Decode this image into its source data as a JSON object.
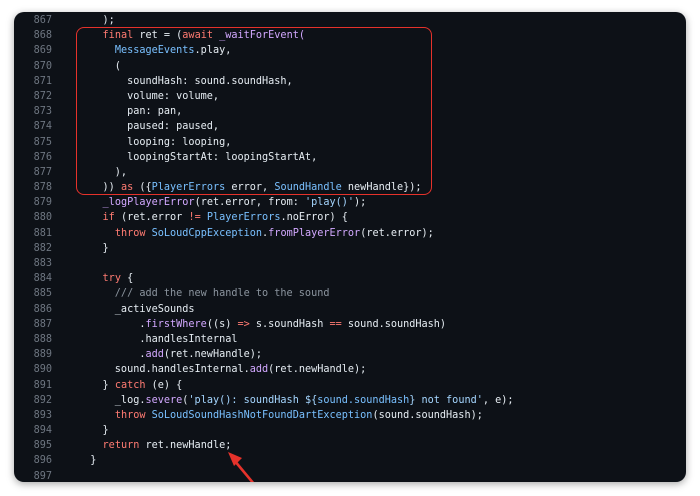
{
  "colors": {
    "background": "#0d1117",
    "keyword": "#ff7b72",
    "function": "#d2a8ff",
    "type": "#79c0ff",
    "string": "#a5d6ff",
    "comment": "#8b949e",
    "plain": "#e6edf3",
    "line_number": "#6e7681",
    "annotation": "#e5322b"
  },
  "code": {
    "lines": [
      {
        "n": "867",
        "tokens": [
          {
            "t": "    );",
            "c": "pl"
          }
        ]
      },
      {
        "n": "868",
        "tokens": [
          {
            "t": "    ",
            "c": "pl"
          },
          {
            "t": "final",
            "c": "kw"
          },
          {
            "t": " ret = (",
            "c": "pl"
          },
          {
            "t": "await",
            "c": "kw"
          },
          {
            "t": " _waitForEvent(",
            "c": "fn"
          }
        ]
      },
      {
        "n": "869",
        "tokens": [
          {
            "t": "      ",
            "c": "pl"
          },
          {
            "t": "MessageEvents",
            "c": "ty"
          },
          {
            "t": ".play,",
            "c": "pl"
          }
        ]
      },
      {
        "n": "870",
        "tokens": [
          {
            "t": "      (",
            "c": "pl"
          }
        ]
      },
      {
        "n": "871",
        "tokens": [
          {
            "t": "        soundHash: sound.soundHash,",
            "c": "pl"
          }
        ]
      },
      {
        "n": "872",
        "tokens": [
          {
            "t": "        volume: volume,",
            "c": "pl"
          }
        ]
      },
      {
        "n": "873",
        "tokens": [
          {
            "t": "        pan: pan,",
            "c": "pl"
          }
        ]
      },
      {
        "n": "874",
        "tokens": [
          {
            "t": "        paused: paused,",
            "c": "pl"
          }
        ]
      },
      {
        "n": "875",
        "tokens": [
          {
            "t": "        looping: looping,",
            "c": "pl"
          }
        ]
      },
      {
        "n": "876",
        "tokens": [
          {
            "t": "        loopingStartAt: loopingStartAt,",
            "c": "pl"
          }
        ]
      },
      {
        "n": "877",
        "tokens": [
          {
            "t": "      ),",
            "c": "pl"
          }
        ]
      },
      {
        "n": "878",
        "tokens": [
          {
            "t": "    )) ",
            "c": "pl"
          },
          {
            "t": "as",
            "c": "kw"
          },
          {
            "t": " ({",
            "c": "pl"
          },
          {
            "t": "PlayerErrors",
            "c": "ty"
          },
          {
            "t": " error, ",
            "c": "pl"
          },
          {
            "t": "SoundHandle",
            "c": "ty"
          },
          {
            "t": " newHandle});",
            "c": "pl"
          }
        ]
      },
      {
        "n": "879",
        "tokens": [
          {
            "t": "    ",
            "c": "pl"
          },
          {
            "t": "_logPlayerError",
            "c": "fn"
          },
          {
            "t": "(ret.error, from: ",
            "c": "pl"
          },
          {
            "t": "'play()'",
            "c": "str"
          },
          {
            "t": ");",
            "c": "pl"
          }
        ]
      },
      {
        "n": "880",
        "tokens": [
          {
            "t": "    ",
            "c": "pl"
          },
          {
            "t": "if",
            "c": "kw"
          },
          {
            "t": " (ret.error ",
            "c": "pl"
          },
          {
            "t": "!=",
            "c": "kw"
          },
          {
            "t": " ",
            "c": "pl"
          },
          {
            "t": "PlayerErrors",
            "c": "ty"
          },
          {
            "t": ".noError) {",
            "c": "pl"
          }
        ]
      },
      {
        "n": "881",
        "tokens": [
          {
            "t": "      ",
            "c": "pl"
          },
          {
            "t": "throw",
            "c": "kw"
          },
          {
            "t": " ",
            "c": "pl"
          },
          {
            "t": "SoLoudCppException",
            "c": "ty"
          },
          {
            "t": ".",
            "c": "pl"
          },
          {
            "t": "fromPlayerError",
            "c": "fn"
          },
          {
            "t": "(ret.error);",
            "c": "pl"
          }
        ]
      },
      {
        "n": "882",
        "tokens": [
          {
            "t": "    }",
            "c": "pl"
          }
        ]
      },
      {
        "n": "883",
        "tokens": []
      },
      {
        "n": "884",
        "tokens": [
          {
            "t": "    ",
            "c": "pl"
          },
          {
            "t": "try",
            "c": "kw"
          },
          {
            "t": " {",
            "c": "pl"
          }
        ]
      },
      {
        "n": "885",
        "tokens": [
          {
            "t": "      /// add the new handle to the sound",
            "c": "cm"
          }
        ]
      },
      {
        "n": "886",
        "tokens": [
          {
            "t": "      _activeSounds",
            "c": "pl"
          }
        ]
      },
      {
        "n": "887",
        "tokens": [
          {
            "t": "          .",
            "c": "pl"
          },
          {
            "t": "firstWhere",
            "c": "fn"
          },
          {
            "t": "((s) ",
            "c": "pl"
          },
          {
            "t": "=>",
            "c": "kw"
          },
          {
            "t": " s.soundHash ",
            "c": "pl"
          },
          {
            "t": "==",
            "c": "kw"
          },
          {
            "t": " sound.soundHash)",
            "c": "pl"
          }
        ]
      },
      {
        "n": "888",
        "tokens": [
          {
            "t": "          .handlesInternal",
            "c": "pl"
          }
        ]
      },
      {
        "n": "889",
        "tokens": [
          {
            "t": "          .",
            "c": "pl"
          },
          {
            "t": "add",
            "c": "fn"
          },
          {
            "t": "(ret.newHandle);",
            "c": "pl"
          }
        ]
      },
      {
        "n": "890",
        "tokens": [
          {
            "t": "      sound.handlesInternal.",
            "c": "pl"
          },
          {
            "t": "add",
            "c": "fn"
          },
          {
            "t": "(ret.newHandle);",
            "c": "pl"
          }
        ]
      },
      {
        "n": "891",
        "tokens": [
          {
            "t": "    } ",
            "c": "pl"
          },
          {
            "t": "catch",
            "c": "kw"
          },
          {
            "t": " (e) {",
            "c": "pl"
          }
        ]
      },
      {
        "n": "892",
        "tokens": [
          {
            "t": "      _log.",
            "c": "pl"
          },
          {
            "t": "severe",
            "c": "fn"
          },
          {
            "t": "(",
            "c": "pl"
          },
          {
            "t": "'play(): soundHash ${",
            "c": "str"
          },
          {
            "t": "sound.soundHash",
            "c": "ty"
          },
          {
            "t": "} not found'",
            "c": "str"
          },
          {
            "t": ", e);",
            "c": "pl"
          }
        ]
      },
      {
        "n": "893",
        "tokens": [
          {
            "t": "      ",
            "c": "pl"
          },
          {
            "t": "throw",
            "c": "kw"
          },
          {
            "t": " ",
            "c": "pl"
          },
          {
            "t": "SoLoudSoundHashNotFoundDartException",
            "c": "ty"
          },
          {
            "t": "(sound.soundHash);",
            "c": "pl"
          }
        ]
      },
      {
        "n": "894",
        "tokens": [
          {
            "t": "    }",
            "c": "pl"
          }
        ]
      },
      {
        "n": "895",
        "tokens": [
          {
            "t": "    ",
            "c": "pl"
          },
          {
            "t": "return",
            "c": "kw"
          },
          {
            "t": " ret.newHandle;",
            "c": "pl"
          }
        ]
      },
      {
        "n": "896",
        "tokens": [
          {
            "t": "  }",
            "c": "pl"
          }
        ]
      },
      {
        "n": "897",
        "tokens": []
      }
    ]
  }
}
